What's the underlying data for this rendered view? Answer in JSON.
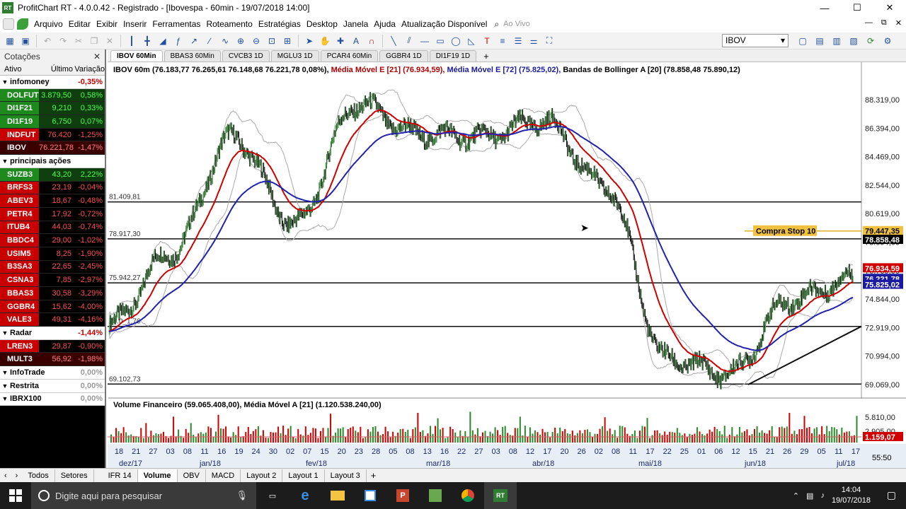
{
  "window": {
    "title": "ProfitChart RT - 4.0.0.42 - Registrado - [Ibovespa - 60min - 19/07/2018 14:00]",
    "app_icon": "RT",
    "minimize": "—",
    "maximize": "☐",
    "close": "✕"
  },
  "menu": {
    "items": [
      "Arquivo",
      "Editar",
      "Exibir",
      "Inserir",
      "Ferramentas",
      "Roteamento",
      "Estratégias",
      "Desktop",
      "Janela",
      "Ajuda",
      "Atualização Disponível"
    ],
    "live": "Ao Vivo",
    "mdi": [
      "—",
      "⧉",
      "✕"
    ]
  },
  "toolbar": {
    "asset": "IBOV"
  },
  "quotes": {
    "title": "Cotações",
    "close": "✕",
    "columns": [
      "Ativo",
      "Último",
      "Variação"
    ],
    "groups": [
      {
        "name": "infomoney",
        "var": "-0,35%",
        "var_color": "#c00000",
        "rows": [
          {
            "sym": "DOLFUT",
            "last": "3.879,50",
            "var": "0,58%",
            "sym_bg": "#1e8a1e",
            "bg": "#0e3d0e",
            "fg": "#4dff4d"
          },
          {
            "sym": "DI1F21",
            "last": "9,210",
            "var": "0,33%",
            "sym_bg": "#1e8a1e",
            "bg": "#0e3d0e",
            "fg": "#4dff4d"
          },
          {
            "sym": "DI1F19",
            "last": "6,750",
            "var": "0,07%",
            "sym_bg": "#1e8a1e",
            "bg": "#0e3d0e",
            "fg": "#4dff4d"
          },
          {
            "sym": "INDFUT",
            "last": "76.420",
            "var": "-1,25%",
            "sym_bg": "#c80000",
            "bg": "#000000",
            "fg": "#ff5050"
          },
          {
            "sym": "IBOV",
            "last": "76.221,78",
            "var": "-1,47%",
            "sym_bg": "#3a0000",
            "bg": "#3a0000",
            "fg": "#ff8080"
          }
        ]
      },
      {
        "name": "principais ações",
        "var": "",
        "var_color": "#000",
        "rows": [
          {
            "sym": "SUZB3",
            "last": "43,20",
            "var": "2,22%",
            "sym_bg": "#1e8a1e",
            "bg": "#0e3d0e",
            "fg": "#4dff4d"
          },
          {
            "sym": "BRFS3",
            "last": "23,19",
            "var": "-0,04%",
            "sym_bg": "#c80000",
            "bg": "#000000",
            "fg": "#ff5050"
          },
          {
            "sym": "ABEV3",
            "last": "18,67",
            "var": "-0,48%",
            "sym_bg": "#c80000",
            "bg": "#000000",
            "fg": "#ff5050"
          },
          {
            "sym": "PETR4",
            "last": "17,92",
            "var": "-0,72%",
            "sym_bg": "#c80000",
            "bg": "#000000",
            "fg": "#ff5050"
          },
          {
            "sym": "ITUB4",
            "last": "44,03",
            "var": "-0,74%",
            "sym_bg": "#c80000",
            "bg": "#000000",
            "fg": "#ff5050"
          },
          {
            "sym": "BBDC4",
            "last": "29,00",
            "var": "-1,02%",
            "sym_bg": "#c80000",
            "bg": "#000000",
            "fg": "#ff5050"
          },
          {
            "sym": "USIM5",
            "last": "8,25",
            "var": "-1,90%",
            "sym_bg": "#c80000",
            "bg": "#000000",
            "fg": "#ff5050"
          },
          {
            "sym": "B3SA3",
            "last": "22,65",
            "var": "-2,45%",
            "sym_bg": "#c80000",
            "bg": "#000000",
            "fg": "#ff5050"
          },
          {
            "sym": "CSNA3",
            "last": "7,85",
            "var": "-2,97%",
            "sym_bg": "#c80000",
            "bg": "#000000",
            "fg": "#ff5050"
          },
          {
            "sym": "BBAS3",
            "last": "30,58",
            "var": "-3,29%",
            "sym_bg": "#c80000",
            "bg": "#000000",
            "fg": "#ff5050"
          },
          {
            "sym": "GGBR4",
            "last": "15,62",
            "var": "-4,00%",
            "sym_bg": "#c80000",
            "bg": "#000000",
            "fg": "#ff5050"
          },
          {
            "sym": "VALE3",
            "last": "49,31",
            "var": "-4,16%",
            "sym_bg": "#c80000",
            "bg": "#000000",
            "fg": "#ff5050"
          }
        ]
      },
      {
        "name": "Radar",
        "var": "-1,44%",
        "var_color": "#c00000",
        "rows": [
          {
            "sym": "LREN3",
            "last": "29,87",
            "var": "-0,90%",
            "sym_bg": "#c80000",
            "bg": "#000000",
            "fg": "#ff5050"
          },
          {
            "sym": "MULT3",
            "last": "56,92",
            "var": "-1,98%",
            "sym_bg": "#3a0000",
            "bg": "#3a0000",
            "fg": "#ff8080"
          }
        ]
      },
      {
        "name": "InfoTrade",
        "var": "0,00%",
        "var_color": "#999",
        "rows": []
      },
      {
        "name": "Restrita",
        "var": "0,00%",
        "var_color": "#999",
        "rows": []
      },
      {
        "name": "IBRX100",
        "var": "0,00%",
        "var_color": "#999",
        "rows": []
      }
    ]
  },
  "chart_tabs": [
    "IBOV 60Min",
    "BBAS3 60Min",
    "CVCB3 1D",
    "MGLU3 1D",
    "PCAR4 60Min",
    "GGBR4 1D",
    "DI1F19 1D"
  ],
  "price_chart": {
    "legend_black": "IBOV 60m (76.183,77  76.265,61  76.148,68  76.221,78  0,08%),",
    "legend_red": "Média Móvel E [21] (76.934,59),",
    "legend_blue": "Média Móvel E [72] (75.825,02),",
    "legend_gray": "Bandas de Bollinger A [20] (78.858,48  75.890,12)",
    "annotation": "Compra Stop 10",
    "h_lines": [
      {
        "label": "81.409,81",
        "value": 81409.81
      },
      {
        "label": "78.917,30",
        "value": 78917.3
      },
      {
        "label": "75.942,27",
        "value": 75942.27
      },
      {
        "label": "73.0_1,76",
        "value": 73000
      },
      {
        "label": "69.102,73",
        "value": 69102.73
      }
    ],
    "tags": [
      {
        "text": "79.447,35",
        "bg": "#f0c040",
        "fg": "#000",
        "value": 79447.35
      },
      {
        "text": "78.858,48",
        "bg": "#000",
        "fg": "#fff",
        "value": 78858.48
      },
      {
        "text": "76.934,59",
        "bg": "#d00000",
        "fg": "#fff",
        "value": 76934.59
      },
      {
        "text": "76.221,78",
        "bg": "#1a1aa0",
        "fg": "#fff",
        "value": 76221.78
      },
      {
        "text": "75.825,02",
        "bg": "#1a1aa0",
        "fg": "#fff",
        "value": 75825.02
      }
    ]
  },
  "volume_chart": {
    "legend": "Volume Financeiro (59.065.408,00), Média Móvel A [21] (1.120.538.240,00)",
    "tag": "1.159,07"
  },
  "x_axis": {
    "days": [
      "18",
      "21",
      "27",
      "03",
      "08",
      "11",
      "16",
      "19",
      "24",
      "30",
      "02",
      "07",
      "15",
      "20",
      "23",
      "28",
      "05",
      "08",
      "13",
      "16",
      "22",
      "27",
      "03",
      "08",
      "12",
      "17",
      "20",
      "26",
      "02",
      "08",
      "11",
      "17",
      "22",
      "25",
      "01",
      "06",
      "12",
      "15",
      "21",
      "26",
      "29",
      "05",
      "11",
      "17"
    ],
    "months": [
      "dez/17",
      "jan/18",
      "fev/18",
      "mar/18",
      "abr/18",
      "mai/18",
      "jun/18",
      "jul/18"
    ],
    "time": "55:50"
  },
  "chart_data": [
    {
      "type": "line",
      "title": "IBOV 60m",
      "series": [
        {
          "name": "IBOV 60m",
          "x": [
            "dez/17",
            "jan/18",
            "jan/18",
            "fev/18",
            "fev/18",
            "mar/18",
            "abr/18",
            "mai/18",
            "mai/18",
            "jun/18",
            "jun/18",
            "jul/18",
            "jul/18"
          ],
          "values": [
            73100,
            78000,
            85800,
            79900,
            88000,
            86000,
            85800,
            86900,
            82500,
            70800,
            69800,
            74800,
            76221.78
          ]
        },
        {
          "name": "Média Móvel E [21]",
          "values": [
            76934.59
          ]
        },
        {
          "name": "Média Móvel E [72]",
          "values": [
            75825.02
          ]
        },
        {
          "name": "Bandas de Bollinger A [20]",
          "values": [
            78858.48,
            75890.12
          ]
        }
      ],
      "y_ticks": [
        "88.319,00",
        "86.394,00",
        "84.469,00",
        "82.544,00",
        "80.619,00",
        "78.694,00",
        "76.769,00",
        "74.844,00",
        "72.919,00",
        "70.994,00",
        "69.069,00"
      ],
      "ylim": [
        68400,
        89800
      ]
    },
    {
      "type": "bar",
      "title": "Volume Financeiro",
      "series": [
        {
          "name": "Volume Financeiro",
          "values": [
            59065408
          ]
        },
        {
          "name": "Média Móvel A [21]",
          "values": [
            1120538240
          ]
        }
      ],
      "y_ticks": [
        "5.810,00",
        "2.905,00"
      ]
    }
  ],
  "bottom_tabs": {
    "left": [
      "Todos",
      "Setores"
    ],
    "chart": [
      "IFR 14",
      "Volume",
      "OBV",
      "MACD",
      "Layout 2",
      "Layout 1",
      "Layout 3"
    ]
  },
  "taskbar": {
    "search": "Digite aqui para pesquisar",
    "time": "14:04",
    "date": "19/07/2018"
  }
}
